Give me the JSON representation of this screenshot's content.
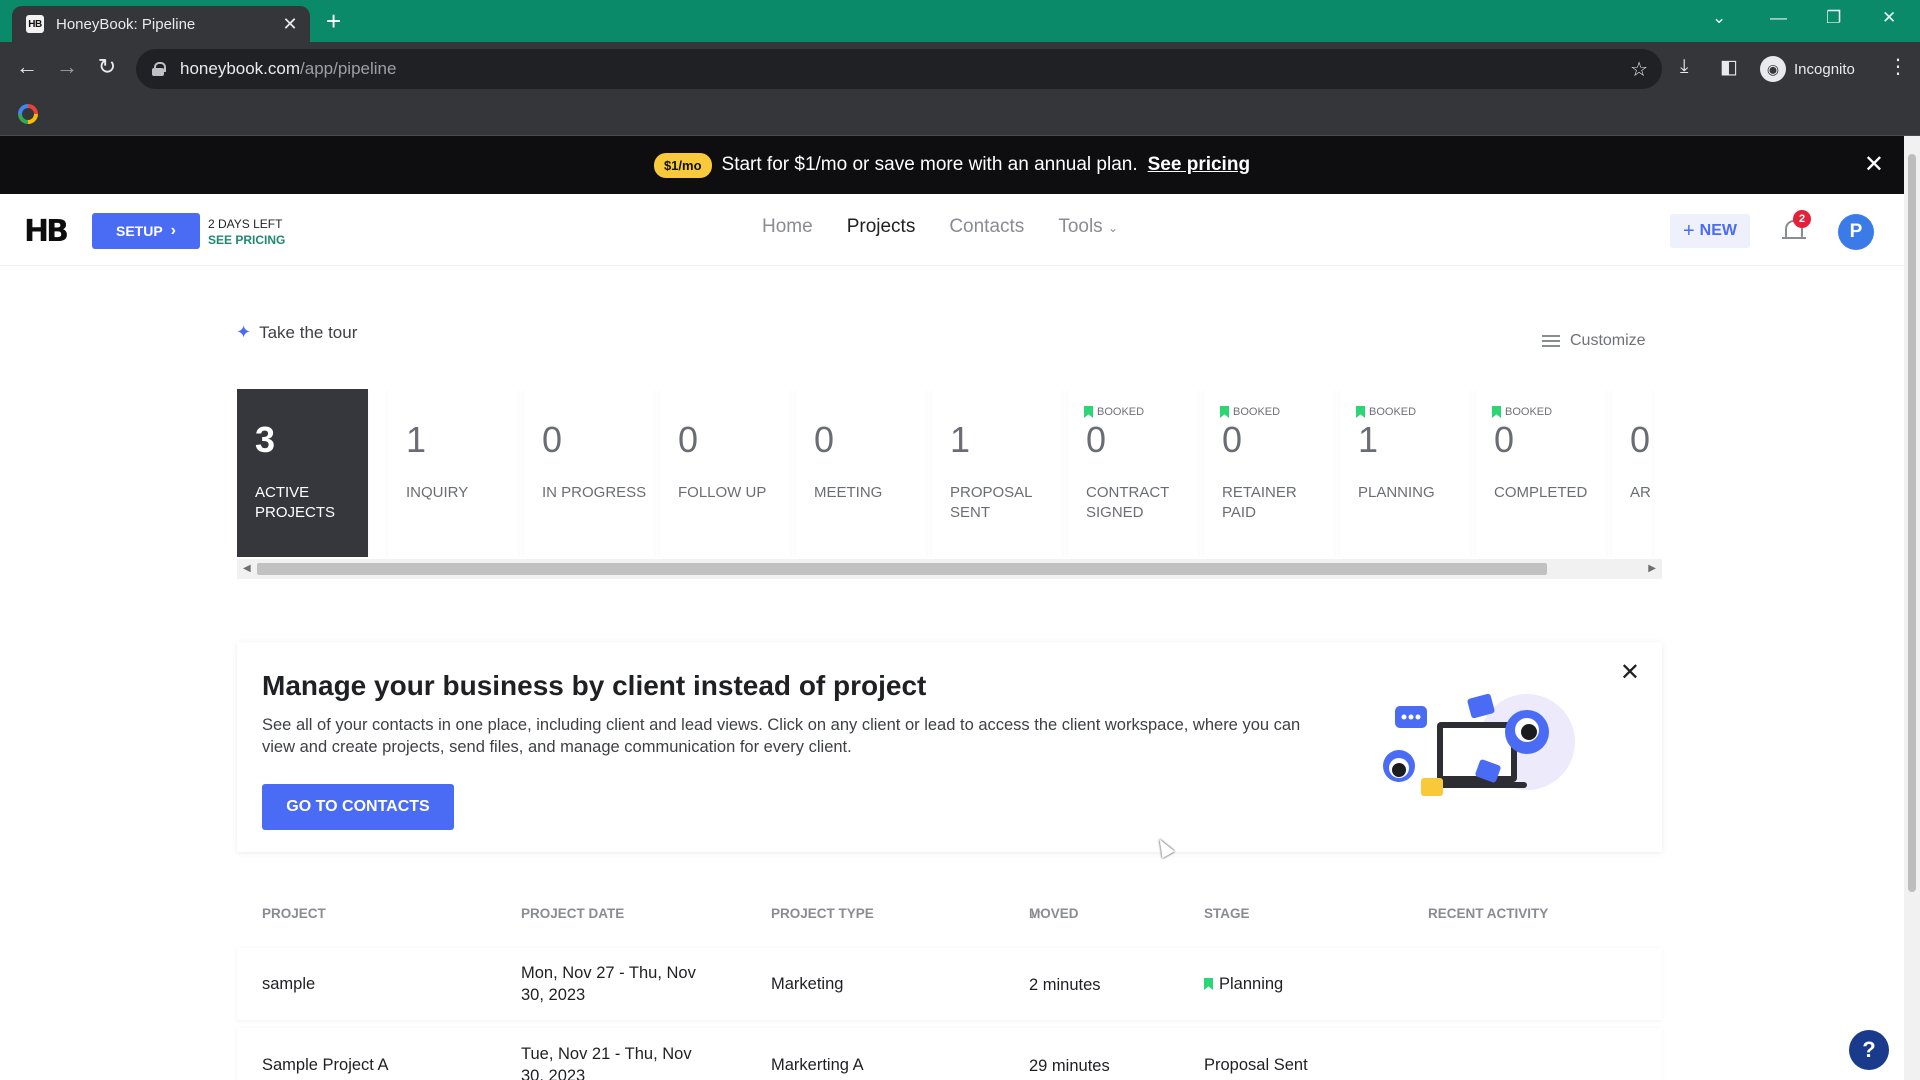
{
  "browser": {
    "tab_title": "HoneyBook: Pipeline",
    "tab_favicon": "HB",
    "url_host": "honeybook.com",
    "url_path": "/app/pipeline",
    "profile_label": "Incognito"
  },
  "promo": {
    "badge": "$1/mo",
    "text": "Start for $1/mo or save more with an annual plan.",
    "link": "See pricing"
  },
  "header": {
    "logo": "HB",
    "setup_label": "SETUP",
    "days_left": "2 DAYS LEFT",
    "see_pricing": "SEE PRICING",
    "nav": [
      "Home",
      "Projects",
      "Contacts",
      "Tools"
    ],
    "new_label": "NEW",
    "notification_count": "2",
    "avatar_initial": "P"
  },
  "page": {
    "tour_label": "Take the tour",
    "customize_label": "Customize"
  },
  "pipeline": [
    {
      "count": "3",
      "label": "ACTIVE PROJECTS",
      "booked": ""
    },
    {
      "count": "1",
      "label": "INQUIRY",
      "booked": ""
    },
    {
      "count": "0",
      "label": "IN PROGRESS",
      "booked": ""
    },
    {
      "count": "0",
      "label": "FOLLOW UP",
      "booked": ""
    },
    {
      "count": "0",
      "label": "MEETING",
      "booked": ""
    },
    {
      "count": "1",
      "label": "PROPOSAL SENT",
      "booked": ""
    },
    {
      "count": "0",
      "label": "CONTRACT SIGNED",
      "booked": "BOOKED"
    },
    {
      "count": "0",
      "label": "RETAINER PAID",
      "booked": "BOOKED"
    },
    {
      "count": "1",
      "label": "PLANNING",
      "booked": "BOOKED"
    },
    {
      "count": "0",
      "label": "COMPLETED",
      "booked": "BOOKED"
    },
    {
      "count": "0",
      "label": "AR",
      "booked": ""
    }
  ],
  "info_card": {
    "title": "Manage your business by client instead of project",
    "description": "See all of your contacts in one place, including client and lead views. Click on any client or lead to access the client workspace, where you can view and create projects, send files, and manage communication for every client.",
    "button": "GO TO CONTACTS"
  },
  "table": {
    "columns": [
      "PROJECT",
      "PROJECT DATE",
      "PROJECT TYPE",
      "MOVED",
      "STAGE",
      "RECENT ACTIVITY"
    ],
    "rows": [
      {
        "project": "sample",
        "date_line1": "Mon, Nov 27 - Thu, Nov",
        "date_line2": "30, 2023",
        "type": "Marketing",
        "moved": "2 minutes",
        "stage": "Planning",
        "recent": ""
      },
      {
        "project": "Sample Project A",
        "date_line1": "Tue, Nov 21 - Thu, Nov",
        "date_line2": "30, 2023",
        "type": "Markerting A",
        "moved": "29 minutes",
        "stage": "Proposal Sent",
        "recent": ""
      }
    ]
  },
  "colors": {
    "accent": "#4a6cf5",
    "booked_flag": "#2bd675",
    "active_card": "#35373d",
    "tab_strip": "#0b8a69"
  }
}
